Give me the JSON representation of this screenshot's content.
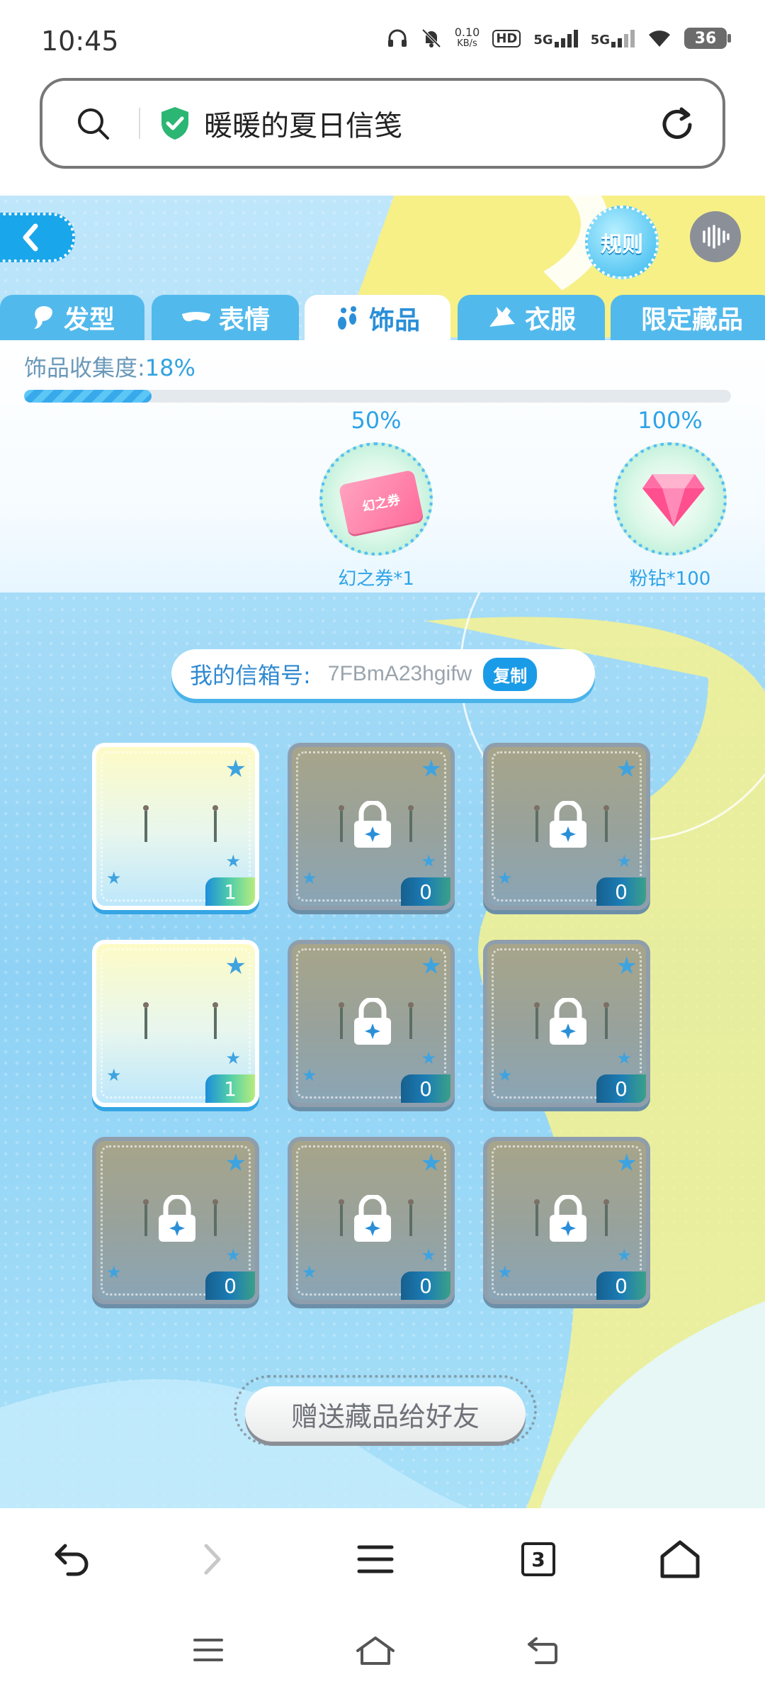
{
  "status_bar": {
    "time": "10:45",
    "speed": "0.10",
    "speed_unit": "KB/s",
    "hd": "HD",
    "net1": "5G",
    "net2": "5G",
    "battery": "36"
  },
  "address_bar": {
    "title": "暖暖的夏日信笺",
    "icons": [
      "search-icon",
      "shield-check-icon",
      "refresh-icon"
    ]
  },
  "game": {
    "back_icon": "chevron-left-icon",
    "rules_label": "规则",
    "sound_icon": "sound-wave-icon",
    "tabs": [
      {
        "label": "发型",
        "icon": "hair-icon",
        "active": false
      },
      {
        "label": "表情",
        "icon": "mask-icon",
        "active": false
      },
      {
        "label": "饰品",
        "icon": "earring-icon",
        "active": true
      },
      {
        "label": "衣服",
        "icon": "clothes-icon",
        "active": false
      },
      {
        "label": "限定藏品",
        "icon": "",
        "active": false
      }
    ],
    "collection": {
      "label": "饰品收集度:",
      "percent_text": "18%",
      "progress": 0.18,
      "milestones": [
        {
          "percent": "50%",
          "reward": "幻之券*1",
          "ticket_text": "幻之券"
        },
        {
          "percent": "100%",
          "reward": "粉钻*100"
        }
      ]
    },
    "mailbox": {
      "label": "我的信箱号:",
      "value": "7FBmA23hgifw",
      "copy_label": "复制"
    },
    "items": [
      {
        "count": "1",
        "owned": true
      },
      {
        "count": "0",
        "owned": false
      },
      {
        "count": "0",
        "owned": false
      },
      {
        "count": "1",
        "owned": true
      },
      {
        "count": "0",
        "owned": false
      },
      {
        "count": "0",
        "owned": false
      },
      {
        "count": "0",
        "owned": false
      },
      {
        "count": "0",
        "owned": false
      },
      {
        "count": "0",
        "owned": false
      }
    ],
    "gift_button": "赠送藏品给好友"
  },
  "browser_toolbar": {
    "tab_count": "3",
    "icons": [
      "back-arrow-icon",
      "forward-arrow-icon",
      "menu-icon",
      "tabs-icon",
      "home-icon"
    ]
  },
  "nav_bar": {
    "icons": [
      "recents-icon",
      "home-nav-icon",
      "back-nav-icon"
    ]
  },
  "colors": {
    "accent": "#1a9be8",
    "tab_bg": "#52b9ec",
    "locked": "#9aa3a0"
  }
}
